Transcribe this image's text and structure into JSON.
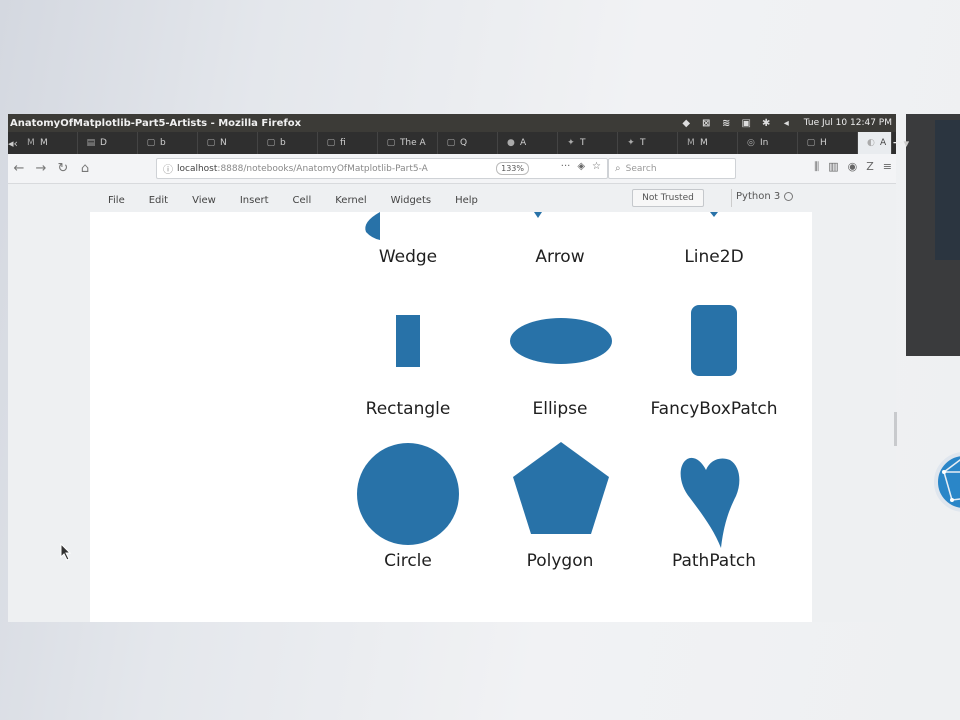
{
  "window": {
    "title": "AnatomyOfMatplotlib-Part5-Artists - Mozilla Firefox",
    "clock": "Tue Jul 10 12:47 PM"
  },
  "tabs": [
    {
      "label": "M",
      "icon": "mail-icon"
    },
    {
      "label": "D",
      "icon": "doc-icon"
    },
    {
      "label": "b",
      "icon": "page-icon"
    },
    {
      "label": "N",
      "icon": "page-icon"
    },
    {
      "label": "b",
      "icon": "page-icon"
    },
    {
      "label": "fi",
      "icon": "page-icon"
    },
    {
      "label": "The A",
      "icon": "page-icon"
    },
    {
      "label": "Q",
      "icon": "page-icon"
    },
    {
      "label": "A",
      "icon": "github-icon"
    },
    {
      "label": "T",
      "icon": "twitter-icon"
    },
    {
      "label": "T",
      "icon": "twitter-icon"
    },
    {
      "label": "M",
      "icon": "mail-icon"
    },
    {
      "label": "In",
      "icon": "instagram-icon"
    },
    {
      "label": "H",
      "icon": "page-icon"
    },
    {
      "label": "A",
      "icon": "jupyter-icon",
      "active": true
    }
  ],
  "address": {
    "host": "localhost",
    "path": ":8888/notebooks/AnatomyOfMatplotlib-Part5-A",
    "zoom": "133%"
  },
  "search": {
    "placeholder": "Search"
  },
  "jupyter": {
    "menu": [
      "File",
      "Edit",
      "View",
      "Insert",
      "Cell",
      "Kernel",
      "Widgets",
      "Help"
    ],
    "trusted": "Not Trusted",
    "kernel": "Python 3"
  },
  "artists": {
    "color": "#2872a8",
    "labels": {
      "wedge": "Wedge",
      "arrow": "Arrow",
      "line2d": "Line2D",
      "rectangle": "Rectangle",
      "ellipse": "Ellipse",
      "fancybox": "FancyBoxPatch",
      "circle": "Circle",
      "polygon": "Polygon",
      "pathpatch": "PathPatch"
    }
  }
}
